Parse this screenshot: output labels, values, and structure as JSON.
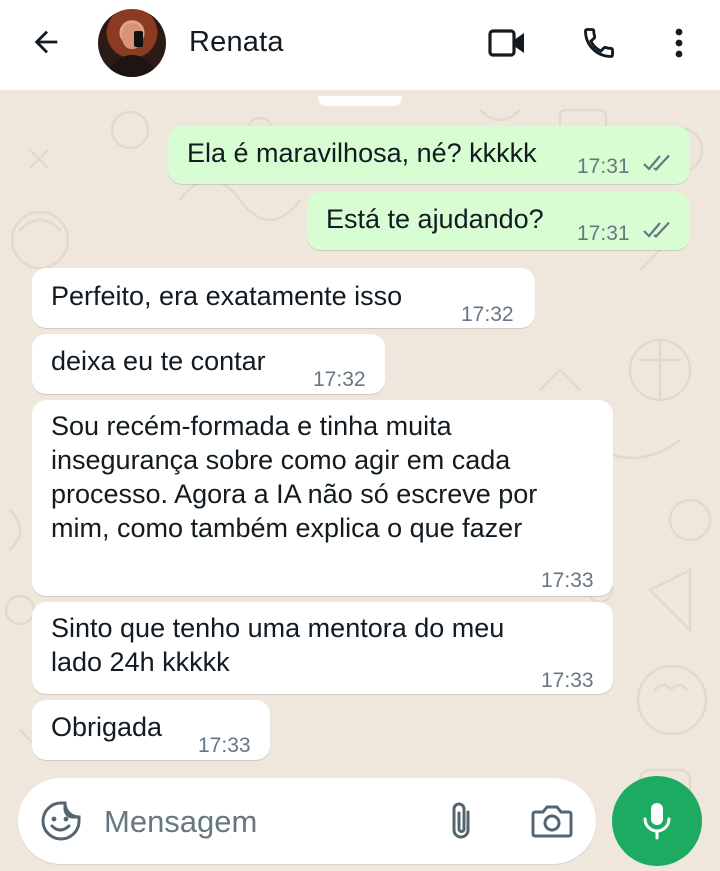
{
  "header": {
    "contact_name": "Renata",
    "icons": [
      "back-arrow-icon",
      "video-call-icon",
      "voice-call-icon",
      "more-options-icon"
    ]
  },
  "messages": [
    {
      "direction": "out",
      "text": "Ela é maravilhosa, né? kkkkk",
      "time": "17:31",
      "status": "read"
    },
    {
      "direction": "out",
      "text": "Está te ajudando?",
      "time": "17:31",
      "status": "read"
    },
    {
      "direction": "in",
      "text": "Perfeito, era exatamente isso",
      "time": "17:32"
    },
    {
      "direction": "in",
      "text": "deixa eu te contar",
      "time": "17:32"
    },
    {
      "direction": "in",
      "lines": [
        "Sou recém-formada e tinha muita",
        "insegurança sobre como agir em cada",
        "processo. Agora a IA não só escreve por",
        "mim, como também explica o que fazer"
      ],
      "time": "17:33"
    },
    {
      "direction": "in",
      "lines": [
        "Sinto que tenho uma mentora do meu",
        "lado 24h kkkkk"
      ],
      "time": "17:33"
    },
    {
      "direction": "in",
      "text": "Obrigada",
      "time": "17:33"
    }
  ],
  "composer": {
    "placeholder": "Mensagem",
    "icons": [
      "sticker-icon",
      "attach-icon",
      "camera-icon",
      "microphone-icon"
    ]
  },
  "colors": {
    "outgoing_bubble": "#d9fdd3",
    "incoming_bubble": "#ffffff",
    "chat_background": "#efe7dc",
    "read_ticks": "#667781",
    "mic_button": "#1daa61"
  }
}
